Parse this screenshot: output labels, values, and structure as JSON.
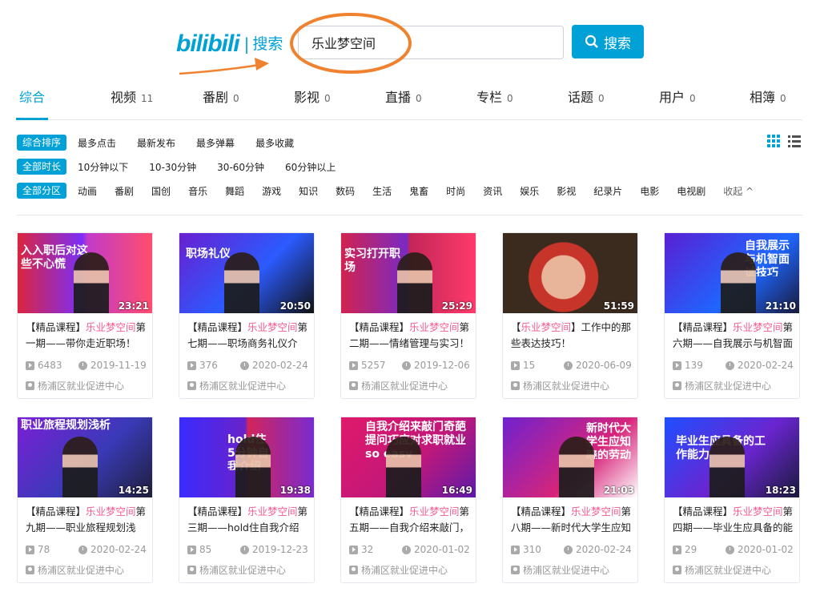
{
  "header": {
    "logo_text": "bilibili",
    "logo_sep": "|",
    "logo_sub": "搜索",
    "query": "乐业梦空间",
    "search_button": "搜索"
  },
  "tabs": [
    {
      "label": "综合",
      "count": ""
    },
    {
      "label": "视频",
      "count": "11"
    },
    {
      "label": "番剧",
      "count": "0"
    },
    {
      "label": "影视",
      "count": "0"
    },
    {
      "label": "直播",
      "count": "0"
    },
    {
      "label": "专栏",
      "count": "0"
    },
    {
      "label": "话题",
      "count": "0"
    },
    {
      "label": "用户",
      "count": "0"
    },
    {
      "label": "相簿",
      "count": "0"
    }
  ],
  "filters": {
    "sort": {
      "tag": "综合排序",
      "items": [
        "最多点击",
        "最新发布",
        "最多弹幕",
        "最多收藏"
      ]
    },
    "duration": {
      "tag": "全部时长",
      "items": [
        "10分钟以下",
        "10-30分钟",
        "30-60分钟",
        "60分钟以上"
      ]
    },
    "zone": {
      "tag": "全部分区",
      "items": [
        "动画",
        "番剧",
        "国创",
        "音乐",
        "舞蹈",
        "游戏",
        "知识",
        "数码",
        "生活",
        "鬼畜",
        "时尚",
        "资讯",
        "娱乐",
        "影视",
        "纪录片",
        "电影",
        "电视剧"
      ],
      "collapse": "收起"
    }
  },
  "videos": [
    {
      "pre": "【精品课程】",
      "hl": "乐业梦空间",
      "post": "第一期——带你走近职场！",
      "duration": "23:21",
      "plays": "6483",
      "date": "2019-11-19",
      "uploader": "杨浦区就业促进中心",
      "thumb_text": "入入职后对这些不心慌"
    },
    {
      "pre": "【精品课程】",
      "hl": "乐业梦空间",
      "post": "第七期——职场商务礼仪介",
      "duration": "20:50",
      "plays": "376",
      "date": "2020-02-24",
      "uploader": "杨浦区就业促进中心",
      "thumb_text": "职场礼仪"
    },
    {
      "pre": "【精品课程】",
      "hl": "乐业梦空间",
      "post": "第二期——情绪管理与实习！",
      "duration": "25:29",
      "plays": "5257",
      "date": "2019-12-06",
      "uploader": "杨浦区就业促进中心",
      "thumb_text": "实习打开职场"
    },
    {
      "pre": "【",
      "hl": "乐业梦空间",
      "post": "】工作中的那些表达技巧！",
      "duration": "51:59",
      "plays": "15",
      "date": "2020-06-09",
      "uploader": "杨浦区就业促进中心",
      "thumb_text": ""
    },
    {
      "pre": "【精品课程】",
      "hl": "乐业梦空间",
      "post": "第六期——自我展示与机智面",
      "duration": "21:10",
      "plays": "139",
      "date": "2020-02-24",
      "uploader": "杨浦区就业促进中心",
      "thumb_text": "自我展示与机智面试技巧"
    },
    {
      "pre": "【精品课程】",
      "hl": "乐业梦空间",
      "post": "第九期——职业旅程规划浅",
      "duration": "14:25",
      "plays": "78",
      "date": "2020-02-24",
      "uploader": "杨浦区就业促进中心",
      "thumb_text": "职业旅程规划浅析"
    },
    {
      "pre": "【精品课程】",
      "hl": "乐业梦空间",
      "post": "第三期——hold住自我介绍",
      "duration": "19:38",
      "plays": "85",
      "date": "2019-12-23",
      "uploader": "杨浦区就业促进中心",
      "thumb_text": "hold住5分钟自我介绍"
    },
    {
      "pre": "【精品课程】",
      "hl": "乐业梦空间",
      "post": "第五期——自我介绍来敲门，",
      "duration": "16:49",
      "plays": "32",
      "date": "2020-01-02",
      "uploader": "杨浦区就业促进中心",
      "thumb_text": "自我介绍来敲门奇葩提问巧应对求职就业so easy"
    },
    {
      "pre": "【精品课程】",
      "hl": "乐业梦空间",
      "post": "第八期——新时代大学生应知",
      "duration": "21:03",
      "plays": "310",
      "date": "2020-02-24",
      "uploader": "杨浦区就业促进中心",
      "thumb_text": "新时代大学生应知晓的劳动法律知识"
    },
    {
      "pre": "【精品课程】",
      "hl": "乐业梦空间",
      "post": "第四期——毕业生应具备的能",
      "duration": "18:23",
      "plays": "29",
      "date": "2020-01-02",
      "uploader": "杨浦区就业促进中心",
      "thumb_text": "毕业生应具备的工作能力"
    }
  ],
  "colors": {
    "accent": "#00a1d6",
    "highlight": "#f25d8e",
    "annotation": "#f0822f"
  }
}
